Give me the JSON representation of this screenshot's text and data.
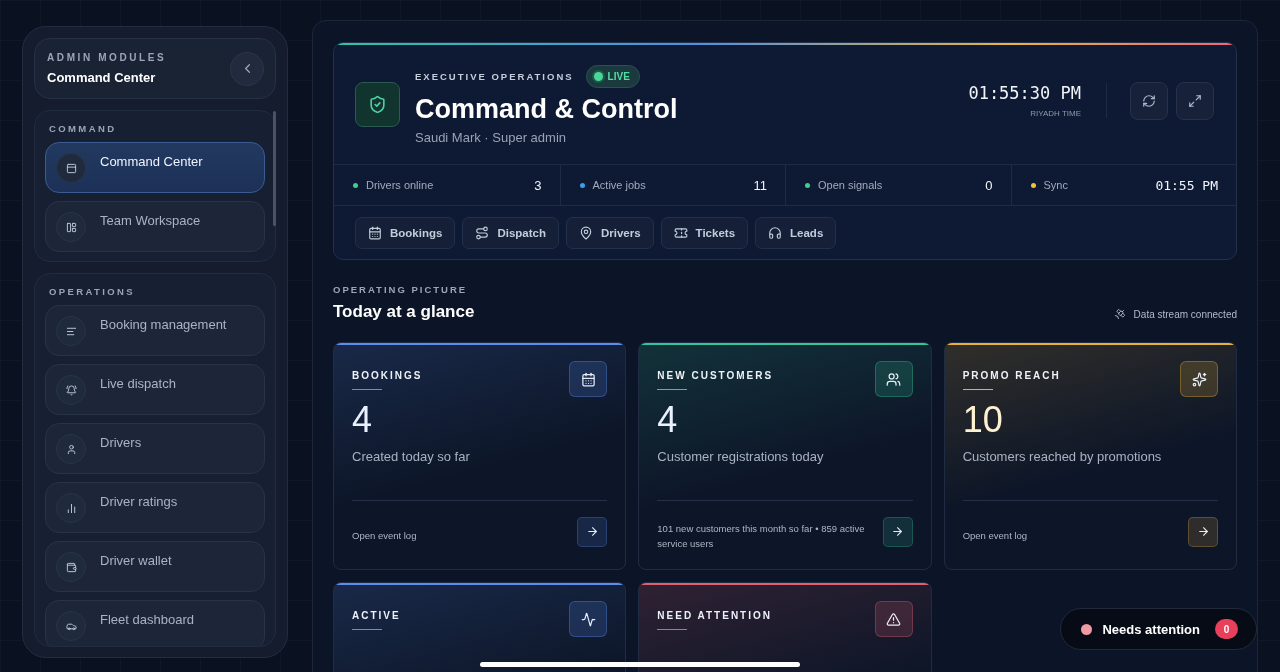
{
  "sidebar": {
    "eyebrow": "ADMIN MODULES",
    "title": "Command Center",
    "sections": [
      {
        "title": "COMMAND",
        "items": [
          {
            "label": "Command Center",
            "selected": true
          },
          {
            "label": "Team Workspace",
            "selected": false
          }
        ]
      },
      {
        "title": "OPERATIONS",
        "items": [
          {
            "label": "Booking management",
            "selected": false
          },
          {
            "label": "Live dispatch",
            "selected": false
          },
          {
            "label": "Drivers",
            "selected": false
          },
          {
            "label": "Driver ratings",
            "selected": false
          },
          {
            "label": "Driver wallet",
            "selected": false
          },
          {
            "label": "Fleet dashboard",
            "selected": false
          }
        ]
      }
    ]
  },
  "header": {
    "eyebrow": "EXECUTIVE OPERATIONS",
    "badge": "LIVE",
    "title": "Command & Control",
    "subtitle": "Saudi Mark · Super admin",
    "clock": "01:55:30 PM",
    "clock_label": "RIYADH TIME",
    "stats": [
      {
        "label": "Drivers online",
        "value": "3",
        "color": "#3ecf8e"
      },
      {
        "label": "Active jobs",
        "value": "11",
        "color": "#3b9fe8"
      },
      {
        "label": "Open signals",
        "value": "0",
        "color": "#3ecf8e"
      },
      {
        "label": "Sync",
        "value": "01:55 PM",
        "color": "#f2c233"
      }
    ],
    "links": [
      "Bookings",
      "Dispatch",
      "Drivers",
      "Tickets",
      "Leads"
    ]
  },
  "overview": {
    "eyebrow": "OPERATING PICTURE",
    "title": "Today at a glance",
    "status": "Data stream connected",
    "cards": [
      {
        "label": "BOOKINGS",
        "value": "4",
        "caption": "Created today so far",
        "footer": "Open event log",
        "color": "#5b8def"
      },
      {
        "label": "NEW CUSTOMERS",
        "value": "4",
        "caption": "Customer registrations today",
        "footer": "101 new customers this month so far • 859 active service users",
        "color": "#34c59a"
      },
      {
        "label": "PROMO REACH",
        "value": "10",
        "caption": "Customers reached by promotions",
        "footer": "Open event log",
        "color": "#e8b23a"
      },
      {
        "label": "ACTIVE",
        "color": "#5b8def"
      },
      {
        "label": "NEED ATTENTION",
        "color": "#e0606e"
      }
    ]
  },
  "attention": {
    "label": "Needs attention",
    "count": "0"
  }
}
